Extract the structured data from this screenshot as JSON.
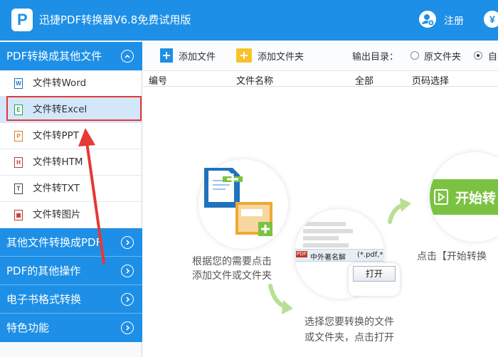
{
  "app": {
    "title": "迅捷PDF转换器V6.8免费试用版",
    "logo_letter": "P"
  },
  "header": {
    "register_label": "注册",
    "yen_symbol": "¥"
  },
  "sidebar": {
    "categories": [
      {
        "label": "PDF转换成其他文件",
        "expanded": true
      },
      {
        "label": "其他文件转换成PDF",
        "expanded": false
      },
      {
        "label": "PDF的其他操作",
        "expanded": false
      },
      {
        "label": "电子书格式转换",
        "expanded": false
      },
      {
        "label": "特色功能",
        "expanded": false
      }
    ],
    "items": [
      {
        "label": "文件转Word",
        "icon_letter": "W",
        "icon_color": "#1e73be"
      },
      {
        "label": "文件转Excel",
        "icon_letter": "E",
        "icon_color": "#2e9e4f",
        "selected": true
      },
      {
        "label": "文件转PPT",
        "icon_letter": "P",
        "icon_color": "#d9822b"
      },
      {
        "label": "文件转HTM",
        "icon_letter": "H",
        "icon_color": "#c0392b"
      },
      {
        "label": "文件转TXT",
        "icon_letter": "T",
        "icon_color": "#444444"
      },
      {
        "label": "文件转图片",
        "icon_letter": "▣",
        "icon_color": "#c0392b"
      }
    ]
  },
  "toolbar": {
    "add_file": "添加文件",
    "add_folder": "添加文件夹",
    "output_label": "输出目录：",
    "radio_original": "原文件夹",
    "radio_custom": "自"
  },
  "table": {
    "headers": [
      "编号",
      "文件名称",
      "全部",
      "页码选择"
    ]
  },
  "steps": {
    "step1_line1": "根据您的需要点击",
    "step1_line2": "添加文件或文件夹",
    "step2_line1": "选择您要转换的文件",
    "step2_line2": "或文件夹，点击打开",
    "step3_text": "点击【开始转换",
    "dialog_pdf_tag": "PDF",
    "dialog_filename": "中外著名解",
    "dialog_filter": "(*.pdf,*.",
    "dialog_open": "打开",
    "start_button": "开始转"
  },
  "colors": {
    "brand": "#1e8fe6",
    "selection_border": "#e53935",
    "green": "#7cc242",
    "arrow": "#e53935"
  }
}
